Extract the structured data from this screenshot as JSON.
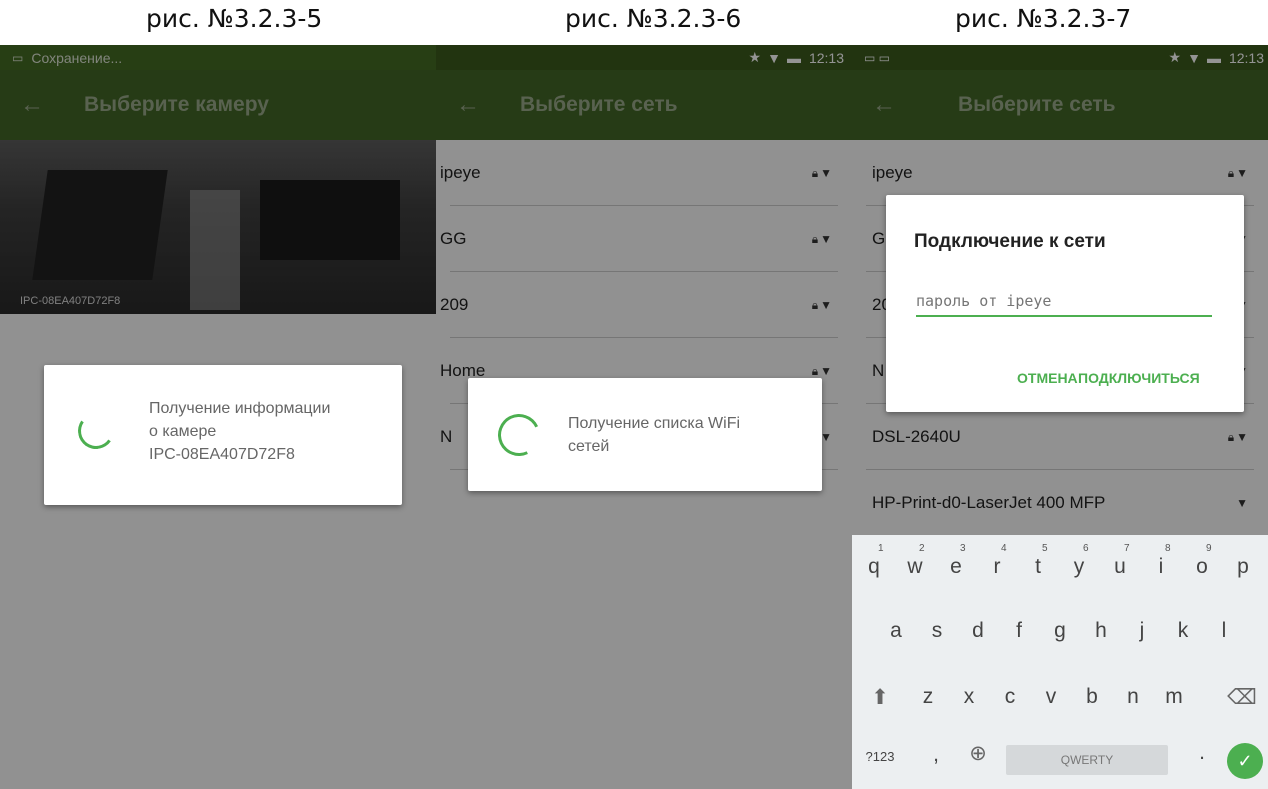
{
  "captions": [
    "рис. №3.2.3-5",
    "рис. №3.2.3-6",
    "рис. №3.2.3-7"
  ],
  "screen1": {
    "status_text": "Сохранение...",
    "title": "Выберите камеру",
    "camera_label": "IPC-08EA407D72F8",
    "dialog_text": [
      "Получение информации",
      "о камере",
      "IPC-08EA407D72F8"
    ]
  },
  "screen2": {
    "time": "12:13",
    "title": "Выберите сеть",
    "networks": [
      "ipeye",
      "GG",
      "209",
      "Home",
      "N"
    ],
    "dialog_text": [
      "Получение списка WiFi",
      "сетей"
    ]
  },
  "screen3": {
    "time": "12:13",
    "title": "Выберите сеть",
    "networks": [
      "ipeye",
      "G",
      "20",
      "N",
      "DSL-2640U",
      "HP-Print-d0-LaserJet 400 MFP"
    ],
    "dialog": {
      "title": "Подключение к сети",
      "placeholder": "пароль от ipeye",
      "cancel": "ОТМЕНА",
      "connect": "ПОДКЛЮЧИТЬСЯ"
    },
    "keyboard": {
      "row1": [
        "q",
        "w",
        "e",
        "r",
        "t",
        "y",
        "u",
        "i",
        "o",
        "p"
      ],
      "row1_digits": [
        "1",
        "2",
        "3",
        "4",
        "5",
        "6",
        "7",
        "8",
        "9",
        ""
      ],
      "row2": [
        "a",
        "s",
        "d",
        "f",
        "g",
        "h",
        "j",
        "k",
        "l"
      ],
      "row3": [
        "z",
        "x",
        "c",
        "v",
        "b",
        "n",
        "m"
      ],
      "symbols": "?123",
      "comma": ",",
      "space": "QWERTY",
      "period": "."
    }
  },
  "colors": {
    "status": "#3b5a1c",
    "appbar": "#436726",
    "accent": "#4caf50"
  },
  "icons": [
    "arrow-back-icon",
    "lock-icon",
    "wifi-icon",
    "star-icon",
    "battery-icon",
    "spinner-icon",
    "globe-icon",
    "shift-icon",
    "backspace-icon",
    "check-icon"
  ]
}
